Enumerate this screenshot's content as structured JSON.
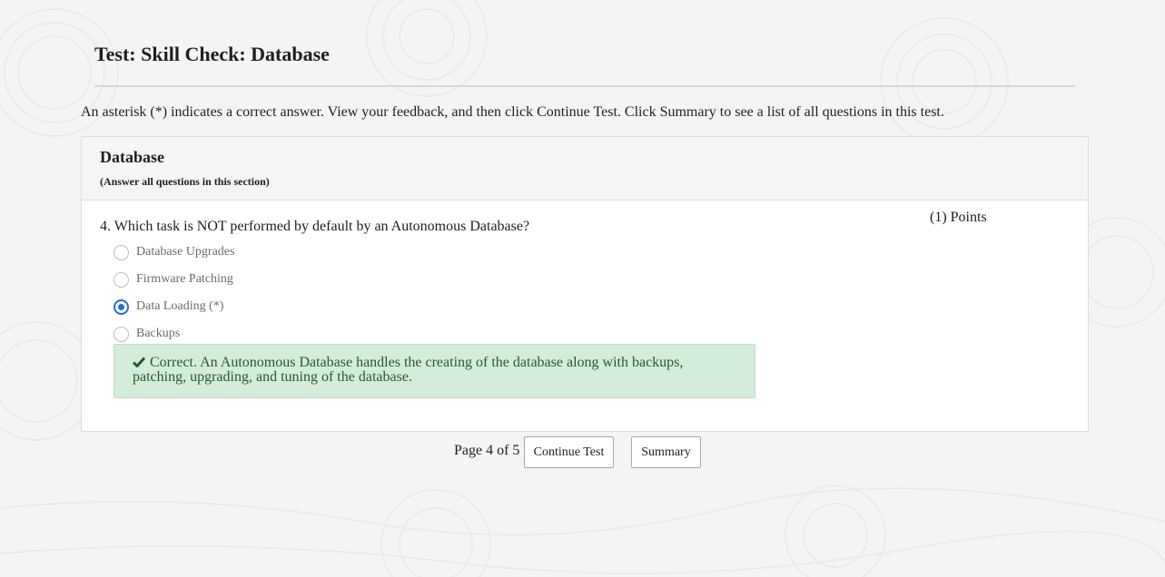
{
  "test": {
    "title": "Test: Skill Check: Database",
    "instructions": "An asterisk (*) indicates a correct answer. View your feedback, and then click Continue Test. Click Summary to see a list of all questions in this test."
  },
  "section": {
    "title": "Database",
    "subtitle": "(Answer all questions in this section)"
  },
  "question": {
    "text": "4. Which task is NOT performed by default by an Autonomous Database?",
    "points": "(1) Points",
    "options": [
      {
        "label": "Database Upgrades",
        "selected": false
      },
      {
        "label": "Firmware Patching",
        "selected": false
      },
      {
        "label": "Data Loading (*)",
        "selected": true
      },
      {
        "label": "Backups",
        "selected": false
      }
    ],
    "feedback_line1": "Correct. An Autonomous Database handles the creating of the database along with backups,",
    "feedback_line2": "patching, upgrading, and tuning of the database.",
    "feedback_icon": "checkmark-icon",
    "feedback_color": "#245c2a"
  },
  "footer": {
    "page_indicator": "Page 4 of 5",
    "continue_label": "Continue Test",
    "summary_label": "Summary"
  },
  "colors": {
    "accent": "#1f6fd0",
    "feedback_bg": "#d4ecd9"
  }
}
